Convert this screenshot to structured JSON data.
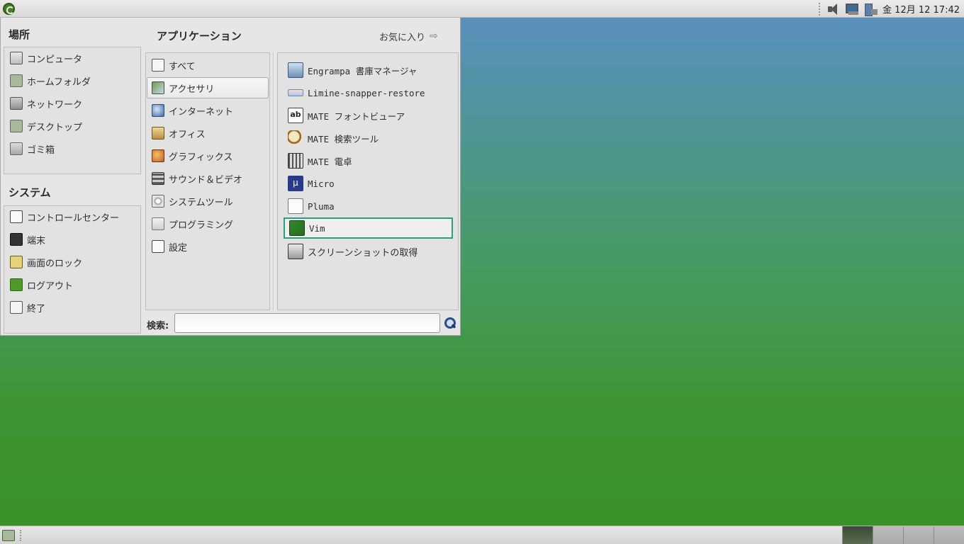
{
  "top_panel": {
    "clock": "金 12月 12 17:42",
    "tray_icons": [
      "volume-icon",
      "network-icon",
      "battery-icon"
    ]
  },
  "menu": {
    "places": {
      "title": "場所",
      "items": [
        {
          "label": "コンピュータ",
          "icon": "computer-icon"
        },
        {
          "label": "ホームフォルダ",
          "icon": "home-folder-icon"
        },
        {
          "label": "ネットワーク",
          "icon": "network-icon"
        },
        {
          "label": "デスクトップ",
          "icon": "desktop-folder-icon"
        },
        {
          "label": "ゴミ箱",
          "icon": "trash-icon"
        }
      ]
    },
    "system": {
      "title": "システム",
      "items": [
        {
          "label": "コントロールセンター",
          "icon": "control-center-icon"
        },
        {
          "label": "端末",
          "icon": "terminal-icon"
        },
        {
          "label": "画面のロック",
          "icon": "lock-icon"
        },
        {
          "label": "ログアウト",
          "icon": "logout-icon"
        },
        {
          "label": "終了",
          "icon": "shutdown-icon"
        }
      ]
    },
    "applications": {
      "title": "アプリケーション",
      "favorites_label": "お気に入り",
      "favorites_arrow": "⇨",
      "categories": [
        {
          "label": "すべて",
          "icon": "all-apps-icon"
        },
        {
          "label": "アクセサリ",
          "icon": "accessories-icon",
          "selected": true
        },
        {
          "label": "インターネット",
          "icon": "internet-icon"
        },
        {
          "label": "オフィス",
          "icon": "office-icon"
        },
        {
          "label": "グラフィックス",
          "icon": "graphics-icon"
        },
        {
          "label": "サウンド＆ビデオ",
          "icon": "sound-video-icon"
        },
        {
          "label": "システムツール",
          "icon": "system-tools-icon"
        },
        {
          "label": "プログラミング",
          "icon": "programming-icon"
        },
        {
          "label": "設定",
          "icon": "settings-icon"
        }
      ],
      "apps": [
        {
          "label": "Engrampa 書庫マネージャ",
          "icon": "archive-manager-icon"
        },
        {
          "label": "Limine-snapper-restore",
          "icon": "limine-icon"
        },
        {
          "label": "MATE フォントビューア",
          "icon": "font-viewer-icon",
          "glyph": "ab"
        },
        {
          "label": "MATE 検索ツール",
          "icon": "search-tool-icon"
        },
        {
          "label": "MATE 電卓",
          "icon": "calculator-icon"
        },
        {
          "label": "Micro",
          "icon": "micro-editor-icon",
          "glyph": "μ"
        },
        {
          "label": "Pluma",
          "icon": "pluma-editor-icon"
        },
        {
          "label": "Vim",
          "icon": "vim-icon",
          "focused": true
        },
        {
          "label": "スクリーンショットの取得",
          "icon": "screenshot-icon"
        }
      ]
    },
    "search": {
      "label": "検索:",
      "value": "",
      "placeholder": ""
    }
  },
  "bottom_panel": {
    "workspaces": 4,
    "active_workspace": 1
  }
}
